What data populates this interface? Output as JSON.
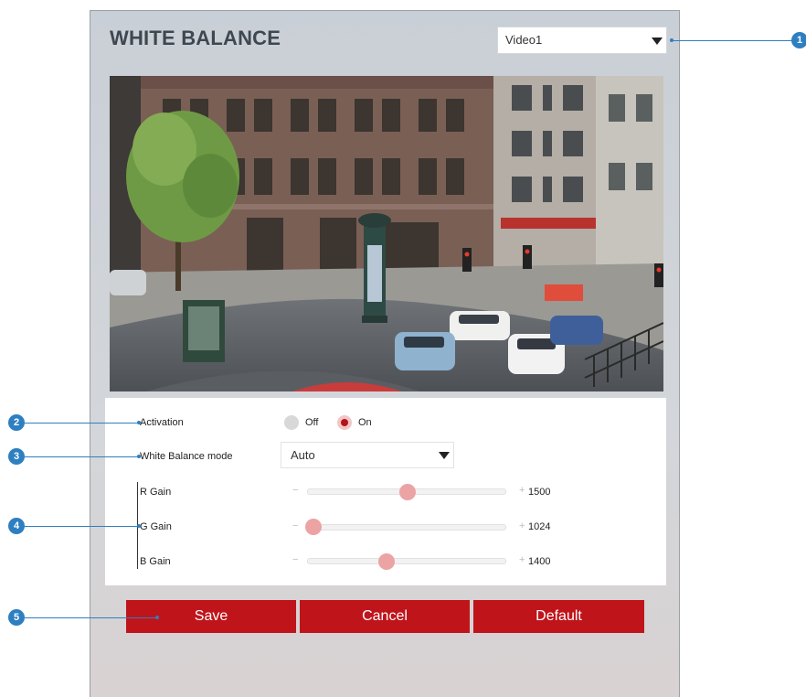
{
  "page": {
    "title": "WHITE BALANCE",
    "video_select": {
      "value": "Video1"
    }
  },
  "settings": {
    "activation": {
      "label": "Activation",
      "options": [
        "Off",
        "On"
      ],
      "selected": "On"
    },
    "wb_mode": {
      "label": "White Balance mode",
      "value": "Auto"
    },
    "gains": [
      {
        "label": "R Gain",
        "value": "1500",
        "level_fraction": 0.5
      },
      {
        "label": "G Gain",
        "value": "1024",
        "level_fraction": 0.03
      },
      {
        "label": "B Gain",
        "value": "1400",
        "level_fraction": 0.4
      }
    ],
    "minus": "−",
    "plus": "+"
  },
  "buttons": {
    "save": "Save",
    "cancel": "Cancel",
    "default": "Default"
  },
  "callouts": [
    "1",
    "2",
    "3",
    "4",
    "5"
  ],
  "colors": {
    "accent_red": "#c0141b",
    "callout_blue": "#2e7fc1",
    "thumb": "#eca3a3"
  },
  "icons": {
    "dropdown": "triangle-down-icon"
  }
}
